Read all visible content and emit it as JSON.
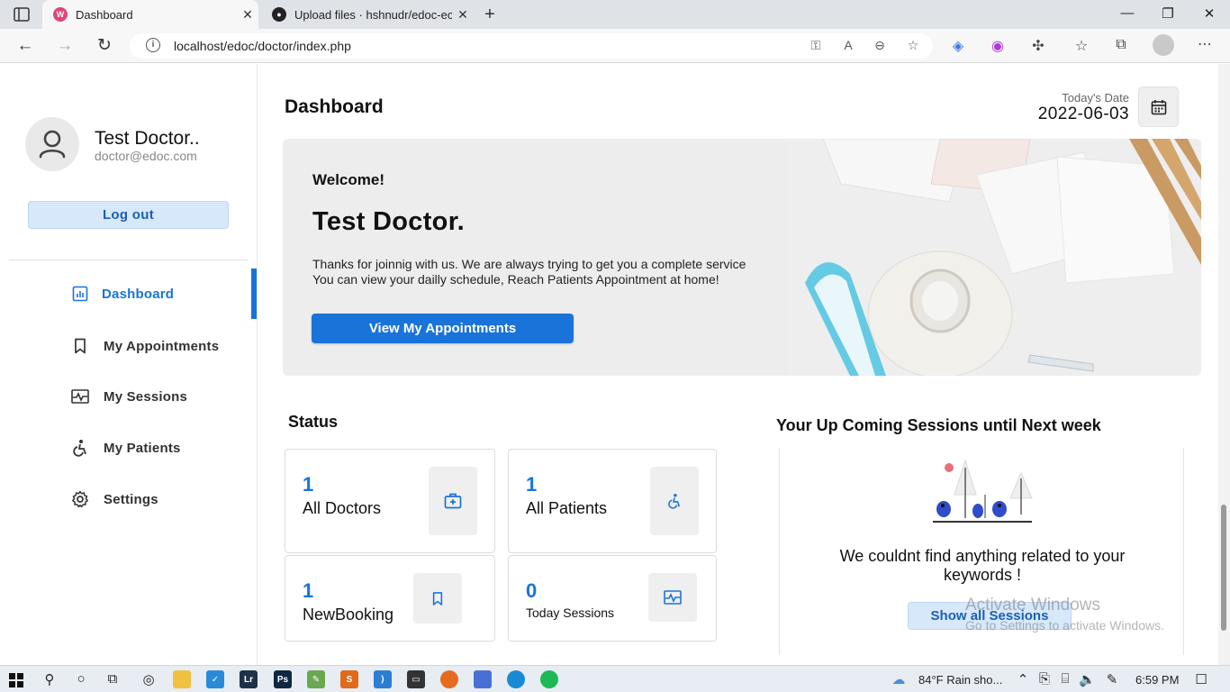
{
  "browser": {
    "tabs": [
      {
        "title": "Dashboard",
        "active": true
      },
      {
        "title": "Upload files · hshnudr/edoc-echa",
        "active": false
      }
    ],
    "url": "localhost/edoc/doctor/index.php"
  },
  "sidebar": {
    "profile_name": "Test Doctor..",
    "profile_email": "doctor@edoc.com",
    "logout_label": "Log out",
    "items": [
      {
        "label": "Dashboard",
        "icon": "dashboard-icon",
        "active": true
      },
      {
        "label": "My Appointments",
        "icon": "bookmark-icon",
        "active": false
      },
      {
        "label": "My Sessions",
        "icon": "sessions-icon",
        "active": false
      },
      {
        "label": "My Patients",
        "icon": "accessibility-icon",
        "active": false
      },
      {
        "label": "Settings",
        "icon": "gear-icon",
        "active": false
      }
    ]
  },
  "header": {
    "title": "Dashboard",
    "date_label": "Today's Date",
    "date_value": "2022-06-03"
  },
  "welcome": {
    "greeting": "Welcome!",
    "name": "Test Doctor.",
    "line1": "Thanks for joinnig with us. We are always trying to get you a complete service",
    "line2": "You can view your dailly schedule, Reach Patients Appointment at home!",
    "button_label": "View My Appointments"
  },
  "status": {
    "title": "Status",
    "cards": [
      {
        "value": "1",
        "label": "All Doctors",
        "icon": "doctor-bag-icon"
      },
      {
        "value": "1",
        "label": "All Patients",
        "icon": "accessibility-icon"
      },
      {
        "value": "1",
        "label": "NewBooking",
        "icon": "bookmark-icon"
      },
      {
        "value": "0",
        "label": "Today Sessions",
        "icon": "sessions-icon"
      }
    ]
  },
  "upcoming": {
    "title": "Your Up Coming Sessions until Next week",
    "empty_message_line1": "We couldnt find anything related to your",
    "empty_message_line2": "keywords !",
    "button_label": "Show all Sessions"
  },
  "watermark": {
    "line1": "Activate Windows",
    "line2": "Go to Settings to activate Windows."
  },
  "taskbar": {
    "weather": "84°F  Rain sho...",
    "time": "6:59 PM"
  },
  "colors": {
    "accent": "#1a73d9",
    "soft_button": "#d7e8fb",
    "card_bg": "#ededed"
  }
}
